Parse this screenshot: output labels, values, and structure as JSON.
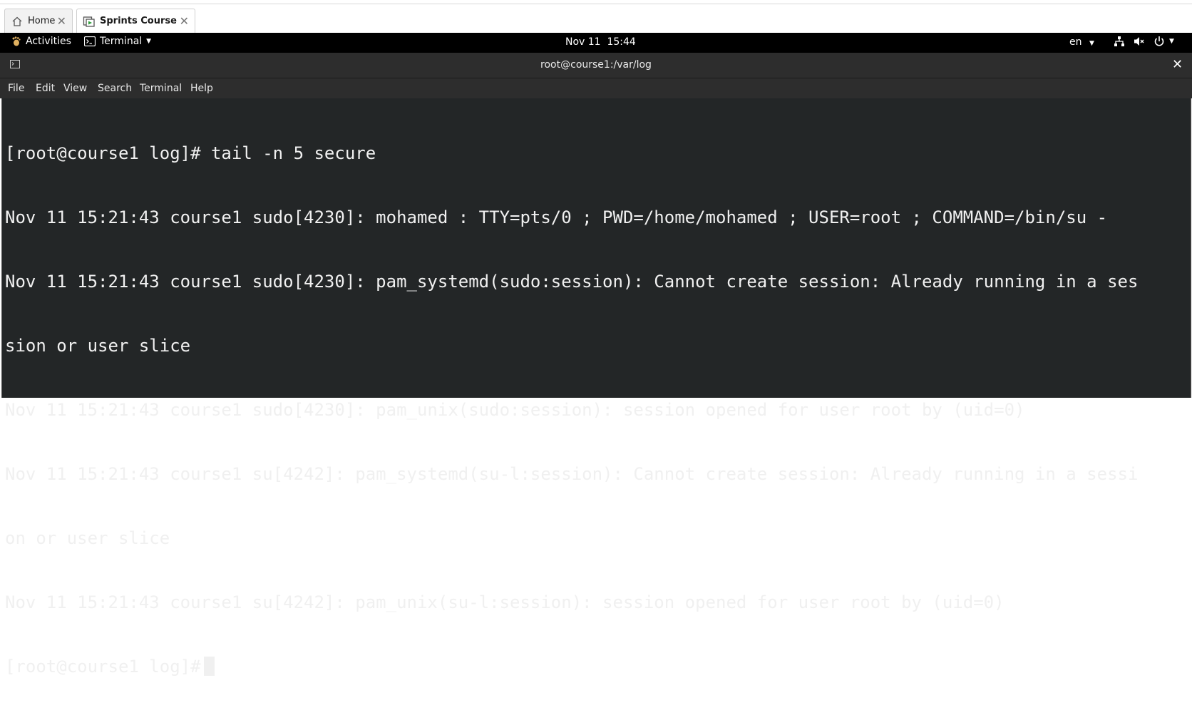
{
  "browser_tabs": [
    {
      "label": "Home",
      "icon": "home-icon",
      "active": false
    },
    {
      "label": "Sprints Course",
      "icon": "vm-icon",
      "active": true
    }
  ],
  "top_bar": {
    "activities": "Activities",
    "app_menu": "Terminal",
    "clock": "Nov 11  15:44",
    "language": "en"
  },
  "window": {
    "title": "root@course1:/var/log"
  },
  "menu": {
    "file": "File",
    "edit": "Edit",
    "view": "View",
    "search": "Search",
    "terminal": "Terminal",
    "help": "Help"
  },
  "terminal": {
    "lines": [
      "[root@course1 log]# tail -n 5 secure",
      "Nov 11 15:21:43 course1 sudo[4230]: mohamed : TTY=pts/0 ; PWD=/home/mohamed ; USER=root ; COMMAND=/bin/su -",
      "Nov 11 15:21:43 course1 sudo[4230]: pam_systemd(sudo:session): Cannot create session: Already running in a ses",
      "sion or user slice",
      "Nov 11 15:21:43 course1 sudo[4230]: pam_unix(sudo:session): session opened for user root by (uid=0)",
      "Nov 11 15:21:43 course1 su[4242]: pam_systemd(su-l:session): Cannot create session: Already running in a sessi",
      "on or user slice",
      "Nov 11 15:21:43 course1 su[4242]: pam_unix(su-l:session): session opened for user root by (uid=0)"
    ],
    "prompt": "[root@course1 log]#"
  },
  "colors": {
    "terminal_bg": "#232627",
    "terminal_fg": "#f0f0f0",
    "titlebar_bg": "#2d2d2d",
    "topbar_bg": "#000000"
  }
}
